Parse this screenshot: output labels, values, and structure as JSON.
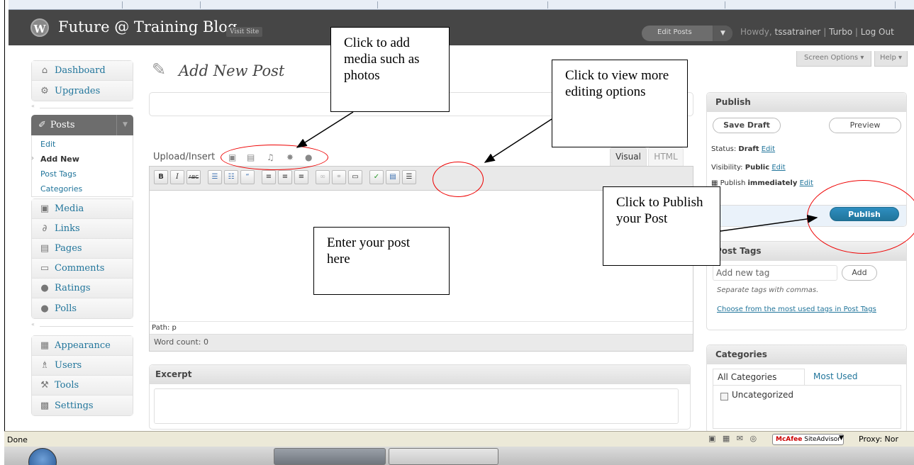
{
  "header": {
    "site_title": "Future @ Training Blog",
    "visit_site": "Visit Site",
    "edit_posts": "Edit Posts",
    "howdy_prefix": "Howdy,",
    "username": "tssatrainer",
    "turbo": "Turbo",
    "logout": "Log Out",
    "logo_glyph": "W",
    "dropdown_glyph": "▼"
  },
  "screen_meta": {
    "screen_options": "Screen Options ▾",
    "help": "Help ▾"
  },
  "sidebar": {
    "top": [
      {
        "label": "Dashboard",
        "icon": "⌂"
      },
      {
        "label": "Upgrades",
        "icon": "⚙"
      }
    ],
    "posts": {
      "label": "Posts",
      "icon": "✐",
      "arrow": "▼",
      "submenu": [
        "Edit",
        "Add New",
        "Post Tags",
        "Categories"
      ]
    },
    "content": [
      {
        "label": "Media",
        "icon": "▣"
      },
      {
        "label": "Links",
        "icon": "∂"
      },
      {
        "label": "Pages",
        "icon": "▤"
      },
      {
        "label": "Comments",
        "icon": "▭"
      },
      {
        "label": "Ratings",
        "icon": "●"
      },
      {
        "label": "Polls",
        "icon": "●"
      }
    ],
    "settings_group": [
      {
        "label": "Appearance",
        "icon": "▦"
      },
      {
        "label": "Users",
        "icon": "♗"
      },
      {
        "label": "Tools",
        "icon": "⚒"
      },
      {
        "label": "Settings",
        "icon": "▩"
      }
    ]
  },
  "main": {
    "page_title": "Add New Post",
    "upload_insert": "Upload/Insert",
    "media_icons": [
      "▣",
      "▤",
      "♫",
      "✸",
      "●"
    ],
    "tab_visual": "Visual",
    "tab_html": "HTML",
    "toolbar_buttons": [
      "B",
      "I",
      "ABC",
      "☰",
      "☷",
      "“",
      "≡",
      "≡",
      "≡",
      "∞",
      "⚭",
      "▭",
      "✓",
      "▤",
      "☰"
    ],
    "path": "Path: p",
    "word_count": "Word count: 0",
    "excerpt_title": "Excerpt"
  },
  "publish": {
    "title": "Publish",
    "save_draft": "Save Draft",
    "preview": "Preview",
    "status_label": "Status:",
    "status_value": "Draft",
    "visibility_label": "Visibility:",
    "visibility_value": "Public",
    "publish_label": "Publish",
    "publish_value": "immediately",
    "edit": "Edit",
    "publish_button": "Publish"
  },
  "tags": {
    "title": "Post Tags",
    "placeholder": "Add new tag",
    "add": "Add",
    "hint": "Separate tags with commas.",
    "choose": "Choose from the most used tags in Post Tags"
  },
  "categories": {
    "title": "Categories",
    "tab_all": "All Categories",
    "tab_used": "Most Used",
    "items": [
      "Uncategorized"
    ]
  },
  "statusbar": {
    "done": "Done",
    "mcafee_brand": "McAfee",
    "mcafee_suffix": "SiteAdvisor",
    "proxy": "Proxy: Nor",
    "icons": "▣ ▦ ✉ ◎"
  },
  "callouts": {
    "media": "Click to add media such as photos",
    "more_options": "Click to view more editing options",
    "publish": "Click to Publish your Post",
    "post": "Enter your post here"
  },
  "colors": {
    "header_bg": "#464646",
    "link": "#21759b",
    "annotation": "#e00000",
    "publish_button": "#21759b"
  }
}
